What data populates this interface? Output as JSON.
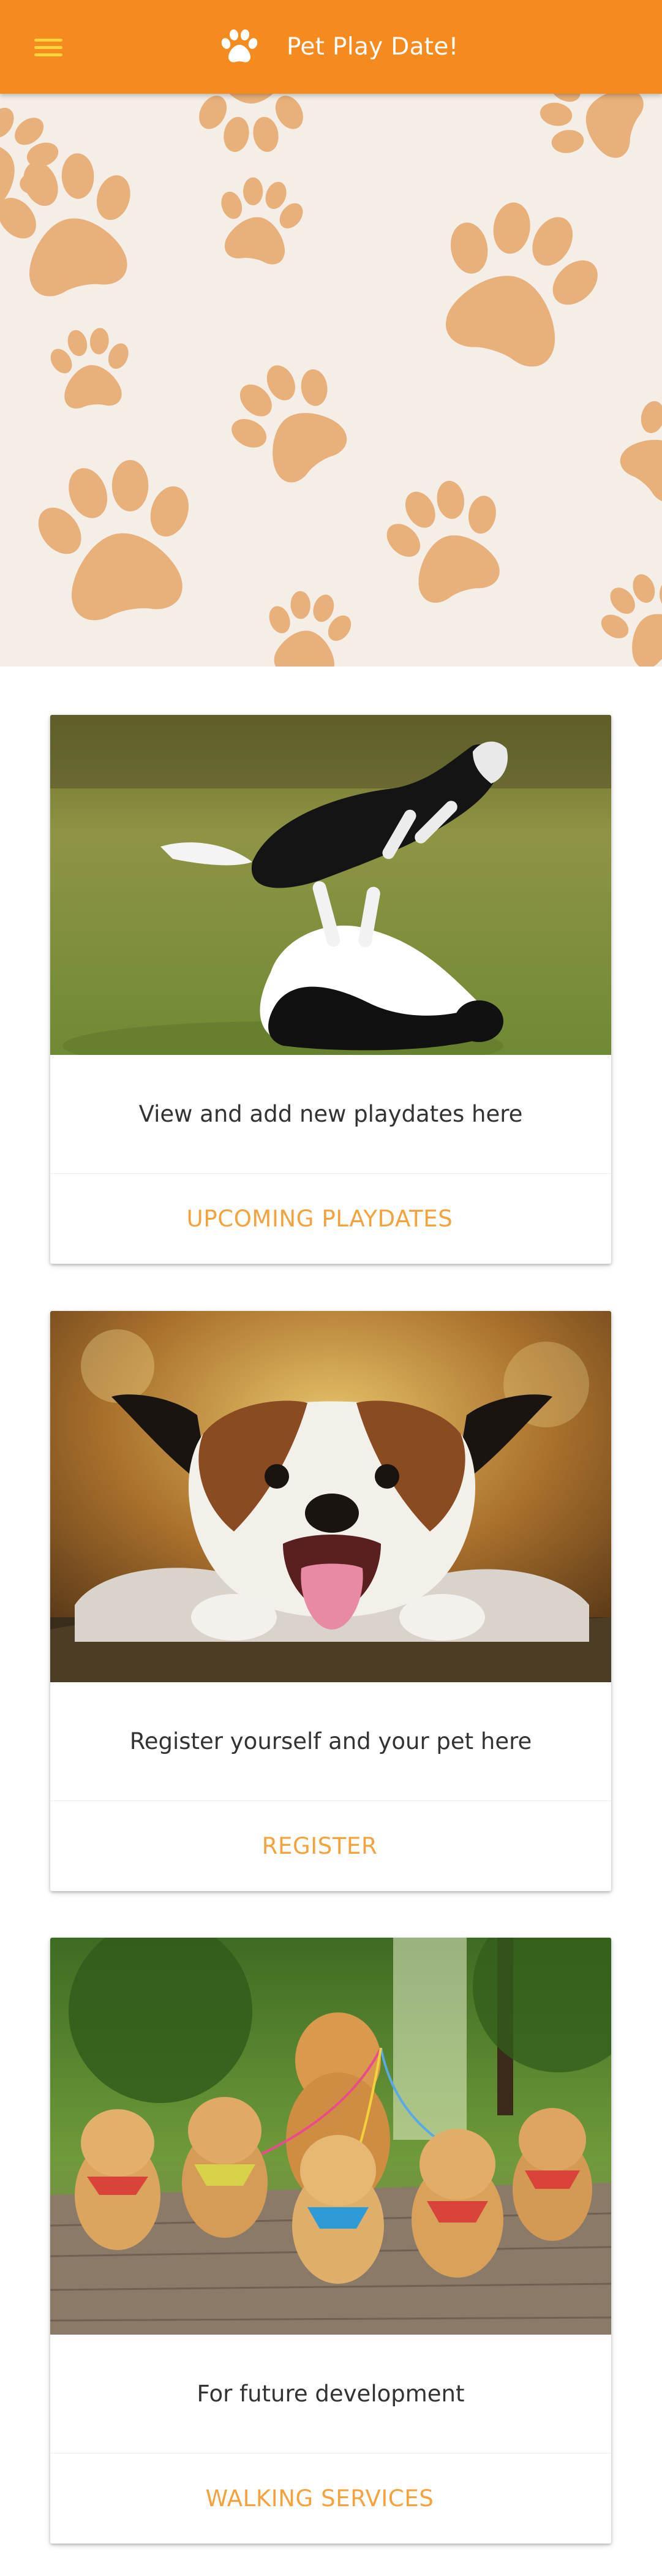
{
  "app": {
    "title": "Pet Play Date!",
    "menu_icon": "hamburger-menu-icon",
    "brand_icon": "paw-print-icon"
  },
  "colors": {
    "toolbar": "#f58a1f",
    "menu_icon": "#ffd43a",
    "hero_background": "#f4eee7",
    "paw": "#e8b07a",
    "action_text": "#f5a23c",
    "body_text": "#333333"
  },
  "cards": [
    {
      "description": "View and add new playdates here",
      "action": "Upcoming Playdates"
    },
    {
      "description": "Register yourself and your pet here",
      "action": "Register"
    },
    {
      "description": "For future development",
      "action": "Walking Services"
    }
  ]
}
